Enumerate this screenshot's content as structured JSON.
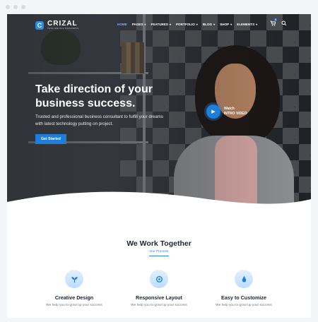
{
  "brand": {
    "name": "CRIZAL",
    "tagline": "TAGLINE ALL BUSINESS",
    "logo_icon": "c-logo-icon"
  },
  "nav": {
    "items": [
      {
        "label": "HOME",
        "active": true,
        "has_caret": false
      },
      {
        "label": "PAGES",
        "active": false,
        "has_caret": true
      },
      {
        "label": "FEATURES",
        "active": false,
        "has_caret": true
      },
      {
        "label": "PORTFOLIO",
        "active": false,
        "has_caret": true
      },
      {
        "label": "BLOG",
        "active": false,
        "has_caret": true
      },
      {
        "label": "SHOP",
        "active": false,
        "has_caret": true
      },
      {
        "label": "ELEMENTS",
        "active": false,
        "has_caret": true
      }
    ],
    "cart_count": "0",
    "icons": [
      "cart-icon",
      "search-icon"
    ]
  },
  "hero": {
    "headline": "Take direction of your business success.",
    "subtext": "Trusted and professional business consultant to fulfill your dreams with latest technology putting on project.",
    "cta_label": "Get Started",
    "video_line1": "Watch",
    "video_line2": "INTRO VIDEO"
  },
  "section": {
    "title": "We Work Together",
    "subtitle": "Our Process"
  },
  "features": [
    {
      "icon": "leaf-icon",
      "title": "Creative Design",
      "desc": "We help you to grow up your success"
    },
    {
      "icon": "layout-icon",
      "title": "Responsive Layout",
      "desc": "We help you to grow up your success"
    },
    {
      "icon": "drop-icon",
      "title": "Easy to Customize",
      "desc": "We help you to grow up your success"
    }
  ],
  "colors": {
    "accent": "#1f7fd8",
    "heading": "#1e2433",
    "body_text": "#6c7280"
  }
}
